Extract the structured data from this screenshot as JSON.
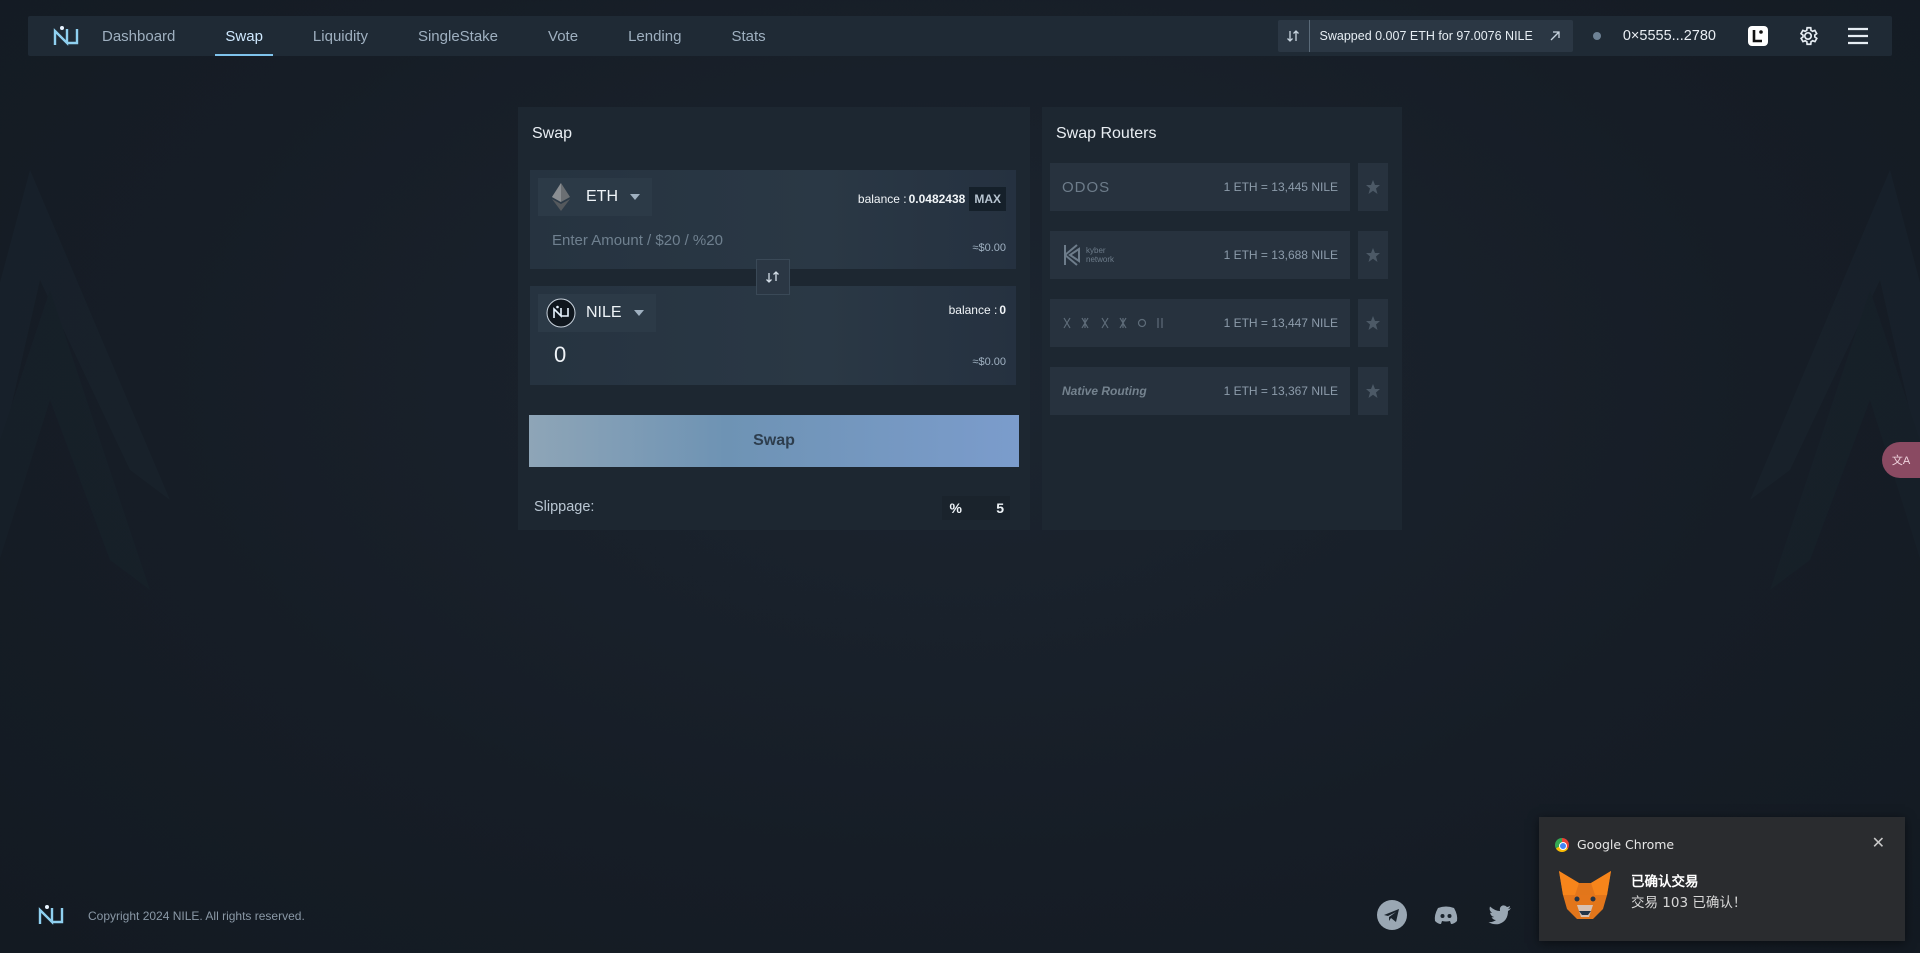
{
  "nav": {
    "links": [
      {
        "label": "Dashboard"
      },
      {
        "label": "Swap"
      },
      {
        "label": "Liquidity"
      },
      {
        "label": "SingleStake"
      },
      {
        "label": "Vote"
      },
      {
        "label": "Lending"
      },
      {
        "label": "Stats"
      }
    ],
    "active": "Swap",
    "recent_tx": "Swapped 0.007 ETH for 97.0076 NILE",
    "wallet_address": "0×5555...2780"
  },
  "swap": {
    "title": "Swap",
    "from": {
      "token": "ETH",
      "balance_label": "balance :",
      "balance_value": "0.0482438",
      "max_label": "MAX",
      "amount_placeholder": "Enter Amount / $20 / %20",
      "usd": "≈$0.00"
    },
    "to": {
      "token": "NILE",
      "balance_label": "balance :",
      "balance_value": "0",
      "amount": "0",
      "usd": "≈$0.00"
    },
    "button_label": "Swap",
    "slippage_label": "Slippage:",
    "slippage_unit": "%",
    "slippage_value": "5"
  },
  "routers": {
    "title": "Swap Routers",
    "items": [
      {
        "name": "ODOS",
        "rate": "1 ETH = 13,445 NILE"
      },
      {
        "name": "kyber network",
        "rate": "1 ETH = 13,688 NILE"
      },
      {
        "name": "",
        "rate": "1 ETH = 13,447 NILE"
      },
      {
        "name": "Native Routing",
        "rate": "1 ETH = 13,367 NILE"
      }
    ]
  },
  "translate_label": "文A",
  "footer": {
    "copyright": "Copyright 2024 NILE. All rights reserved."
  },
  "notification": {
    "app": "Google Chrome",
    "title": "已确认交易",
    "body": "交易 103 已确认！"
  },
  "colors": {
    "accent": "#7fc3ec",
    "panel": "#1d2731",
    "background": "#161d26"
  }
}
